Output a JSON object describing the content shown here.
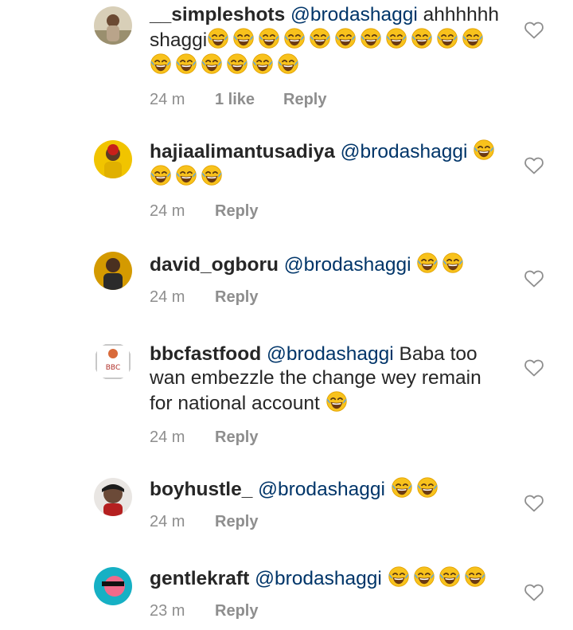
{
  "comments": [
    {
      "username": "__simpleshots",
      "mention": "@brodashaggi",
      "text_parts": [
        "ahhhhhh shaggi"
      ],
      "emoji_count": 17,
      "time": "24 m",
      "likes": "1 like",
      "reply": "Reply",
      "avatar_color": "#c9b089"
    },
    {
      "username": "hajiaalimantusadiya",
      "mention": "@brodashaggi",
      "text_parts": [
        ""
      ],
      "emoji_count": 4,
      "time": "24 m",
      "likes": "",
      "reply": "Reply",
      "avatar_color": "#f2c900"
    },
    {
      "username": "david_ogboru",
      "mention": "@brodashaggi",
      "text_parts": [
        ""
      ],
      "emoji_count": 2,
      "time": "24 m",
      "likes": "",
      "reply": "Reply",
      "avatar_color": "#d9a400"
    },
    {
      "username": "bbcfastfood",
      "mention": "@brodashaggi",
      "text_parts": [
        "Baba too wan embezzle the change wey remain for national account"
      ],
      "emoji_count": 1,
      "time": "24 m",
      "likes": "",
      "reply": "Reply",
      "avatar_color": "#ffffff"
    },
    {
      "username": "boyhustle_",
      "mention": "@brodashaggi",
      "text_parts": [
        ""
      ],
      "emoji_count": 2,
      "time": "24 m",
      "likes": "",
      "reply": "Reply",
      "avatar_color": "#3a2a22"
    },
    {
      "username": "gentlekraft",
      "mention": "@brodashaggi",
      "text_parts": [
        ""
      ],
      "emoji_count": 4,
      "time": "23 m",
      "likes": "",
      "reply": "Reply",
      "avatar_color": "#1bb3c7"
    }
  ],
  "colors": {
    "username": "#262626",
    "mention": "#003569",
    "meta": "#8e8e8e",
    "heart_outline": "#8e8e8e"
  },
  "icons": {
    "emoji": "face-with-tears-of-joy-icon",
    "like": "heart-outline-icon"
  }
}
